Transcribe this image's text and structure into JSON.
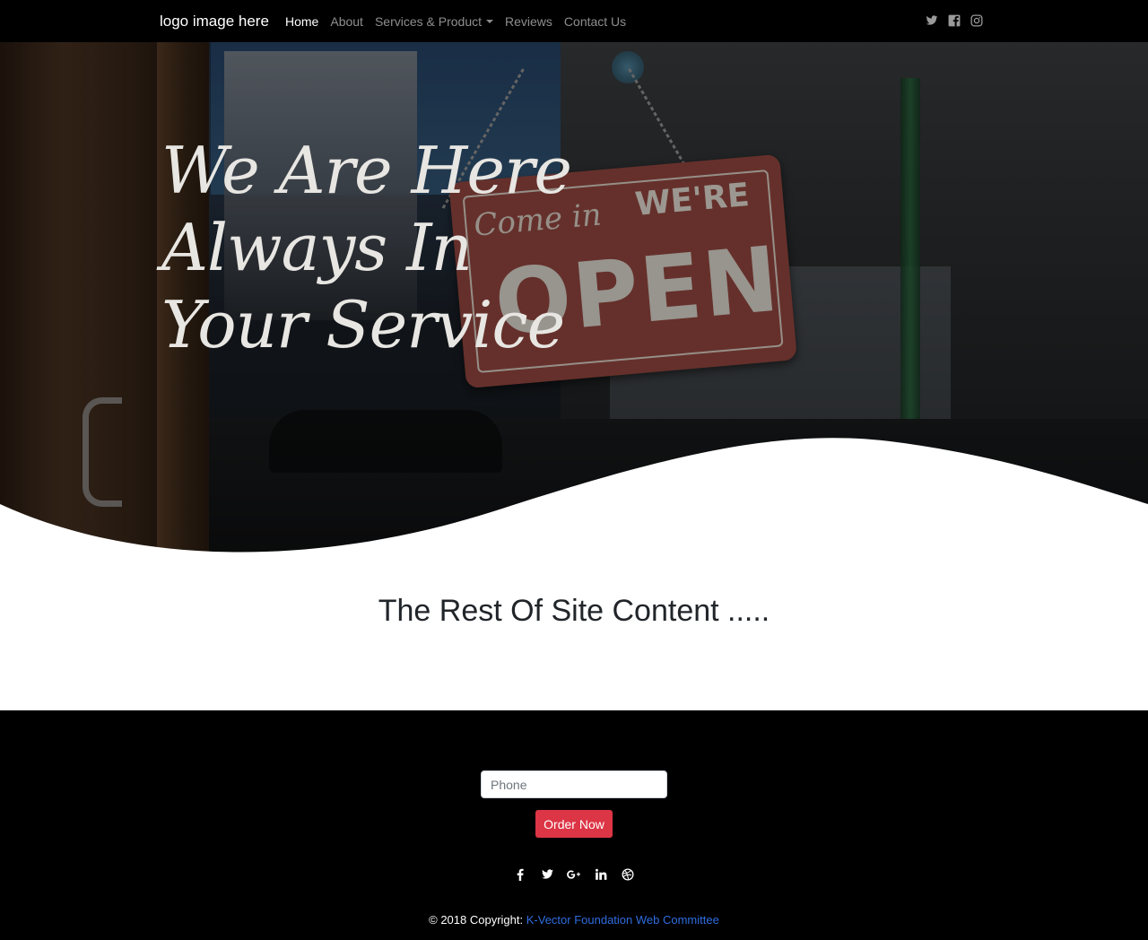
{
  "navbar": {
    "brand": "logo image here",
    "links": [
      {
        "label": "Home",
        "active": true
      },
      {
        "label": "About"
      },
      {
        "label": "Services & Product",
        "dropdown": true
      },
      {
        "label": "Reviews"
      },
      {
        "label": "Contact Us"
      }
    ],
    "social_icons": [
      "twitter-icon",
      "facebook-icon",
      "instagram-icon"
    ]
  },
  "hero": {
    "title_lines": [
      "We Are Here",
      "Always In",
      "Your Service"
    ],
    "sign": {
      "line1": "Come in",
      "line2": "WE'RE",
      "line3": "OPEN"
    }
  },
  "content": {
    "title": "The Rest Of Site Content ....."
  },
  "footer": {
    "phone_placeholder": "Phone",
    "order_button": "Order Now",
    "social_icons": [
      "facebook-icon",
      "twitter-icon",
      "google-plus-icon",
      "linkedin-icon",
      "dribbble-icon"
    ],
    "copyright_text": "© 2018 Copyright:",
    "copyright_link": "K-Vector Foundation Web Committee"
  },
  "colors": {
    "navbar_bg": "#000000",
    "footer_bg": "#000000",
    "button_red": "#dc3545",
    "link_blue": "#2f6de0"
  }
}
